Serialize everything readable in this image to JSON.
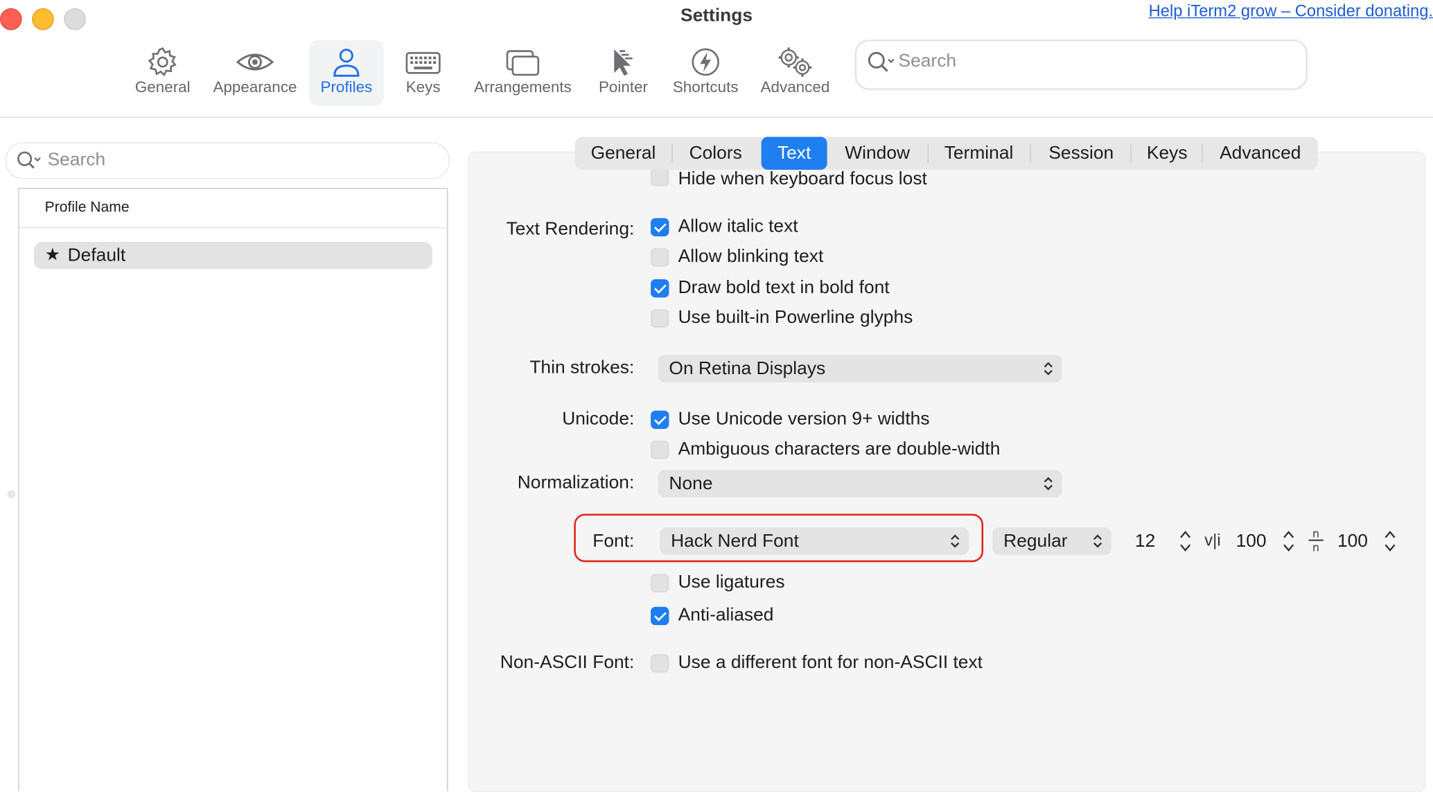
{
  "window": {
    "title": "Settings",
    "donate_link": "Help iTerm2 grow – Consider donating."
  },
  "toolbar": {
    "items": [
      {
        "label": "General",
        "icon": "gear-icon"
      },
      {
        "label": "Appearance",
        "icon": "eye-icon"
      },
      {
        "label": "Profiles",
        "icon": "person-icon",
        "active": true
      },
      {
        "label": "Keys",
        "icon": "keyboard-icon"
      },
      {
        "label": "Arrangements",
        "icon": "windows-icon"
      },
      {
        "label": "Pointer",
        "icon": "pointer-icon"
      },
      {
        "label": "Shortcuts",
        "icon": "lightning-icon"
      },
      {
        "label": "Advanced",
        "icon": "gears-icon"
      }
    ],
    "search_placeholder": "Search"
  },
  "profiles": {
    "search_placeholder": "Search",
    "column_header": "Profile Name",
    "items": [
      {
        "name": "Default",
        "default": true,
        "selected": true
      }
    ]
  },
  "tabs": [
    {
      "label": "General"
    },
    {
      "label": "Colors"
    },
    {
      "label": "Text",
      "selected": true
    },
    {
      "label": "Window"
    },
    {
      "label": "Terminal"
    },
    {
      "label": "Session"
    },
    {
      "label": "Keys"
    },
    {
      "label": "Advanced"
    }
  ],
  "text_settings": {
    "partial_top_option": {
      "label": "Hide when keyboard focus lost",
      "checked": false
    },
    "text_rendering": {
      "label": "Text Rendering:",
      "options": [
        {
          "label": "Allow italic text",
          "checked": true
        },
        {
          "label": "Allow blinking text",
          "checked": false
        },
        {
          "label": "Draw bold text in bold font",
          "checked": true
        },
        {
          "label": "Use built-in Powerline glyphs",
          "checked": false
        }
      ]
    },
    "thin_strokes": {
      "label": "Thin strokes:",
      "value": "On Retina Displays"
    },
    "unicode": {
      "label": "Unicode:",
      "options": [
        {
          "label": "Use Unicode version 9+ widths",
          "checked": true
        },
        {
          "label": "Ambiguous characters are double-width",
          "checked": false
        }
      ]
    },
    "normalization": {
      "label": "Normalization:",
      "value": "None"
    },
    "font": {
      "label": "Font:",
      "family": "Hack Nerd Font",
      "weight": "Regular",
      "size": "12",
      "vertical_spacing": "100",
      "horizontal_spacing": "100",
      "options": [
        {
          "label": "Use ligatures",
          "checked": false
        },
        {
          "label": "Anti-aliased",
          "checked": true
        }
      ]
    },
    "non_ascii_font": {
      "label": "Non-ASCII Font:",
      "option": {
        "label": "Use a different font for non-ASCII text",
        "checked": false
      }
    }
  },
  "colors": {
    "accent": "#1f7ef0",
    "highlight_outline": "#e02a1d",
    "link": "#1f5bd1"
  }
}
